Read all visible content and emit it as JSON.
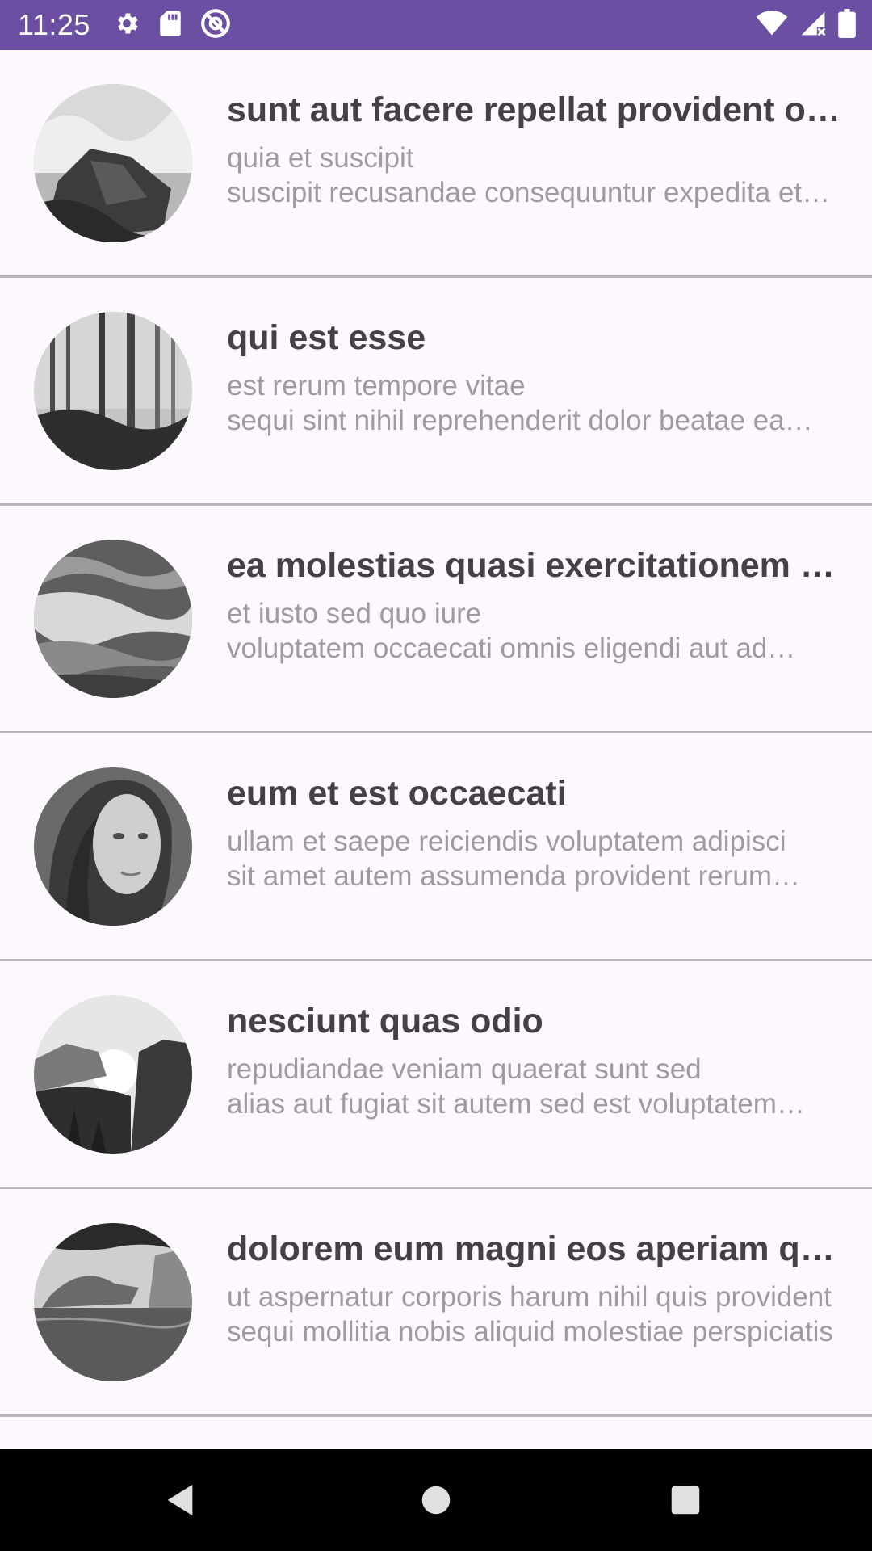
{
  "status_bar": {
    "time": "11:25",
    "left_icons": [
      "gear-icon",
      "sd-card-icon",
      "at-sign-icon"
    ],
    "right_icons": [
      "wifi-icon",
      "cell-signal-icon",
      "battery-icon"
    ],
    "background": "#6a4fa3"
  },
  "posts": [
    {
      "title": "sunt aut facere repellat provident occaecati excepturi optio reprehenderit",
      "body": "quia et suscipit\nsuscipit recusandae consequuntur expedita et cum reprehenderit molestiae ut ut quas totam",
      "image": "waves-on-rocks"
    },
    {
      "title": "qui est esse",
      "body": "est rerum tempore vitae\nsequi sint nihil reprehenderit dolor beatae ea dolores neque fugiat blanditiis",
      "image": "misty-forest"
    },
    {
      "title": "ea molestias quasi exercitationem repellat qui ipsa sit aut",
      "body": "et iusto sed quo iure\nvoluptatem occaecati omnis eligendi aut ad voluptatem doloribus vel accusantium",
      "image": "sea-waves"
    },
    {
      "title": "eum et est occaecati",
      "body": "ullam et saepe reiciendis voluptatem adipisci\nsit amet autem assumenda provident rerum culpa quis hic commodi",
      "image": "woman-portrait"
    },
    {
      "title": "nesciunt quas odio",
      "body": "repudiandae veniam quaerat sunt sed\nalias aut fugiat sit autem sed est voluptatem omnis possimus esse voluptatibus quis",
      "image": "mountain-sunset"
    },
    {
      "title": "dolorem eum magni eos aperiam quia",
      "body": "ut aspernatur corporis harum nihil quis provident sequi mollitia nobis aliquid molestiae perspiciatis",
      "image": "coastal-cliffs"
    }
  ],
  "nav_bar": {
    "buttons": [
      "back-icon",
      "home-icon",
      "recents-icon"
    ]
  }
}
